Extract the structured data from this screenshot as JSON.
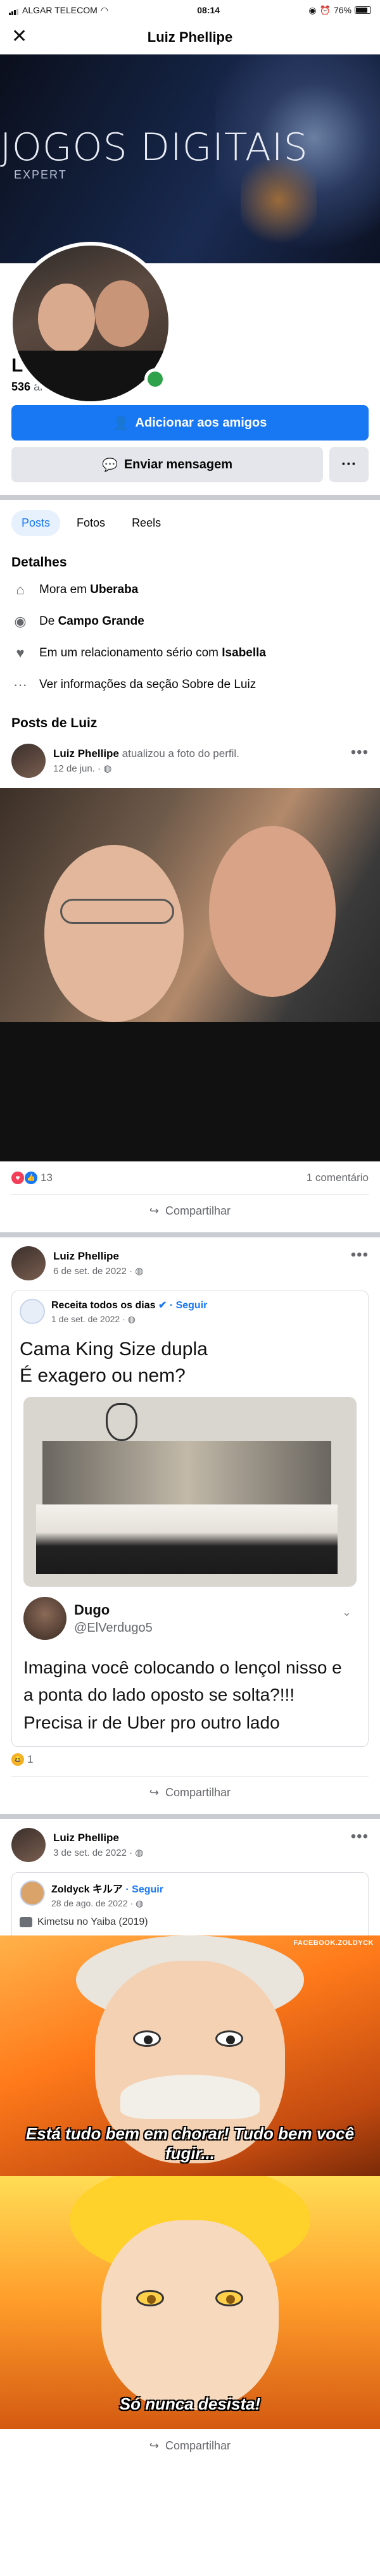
{
  "status_bar": {
    "carrier": "ALGAR TELECOM",
    "time": "08:14",
    "battery": "76%"
  },
  "header": {
    "title": "Luiz Phellipe"
  },
  "cover": {
    "brand": "JOGOS DIGITAIS",
    "brand_sub": "EXPERT"
  },
  "profile": {
    "name": "Luiz Phellipe",
    "friends_count": "536",
    "friends_label": "amigos",
    "add_friend_label": "Adicionar aos amigos",
    "message_label": "Enviar mensagem",
    "more_label": "···"
  },
  "tabs": [
    {
      "label": "Posts"
    },
    {
      "label": "Fotos"
    },
    {
      "label": "Reels"
    }
  ],
  "details": {
    "title": "Detalhes",
    "lives_prefix": "Mora em",
    "lives_city": "Uberaba",
    "from_prefix": "De",
    "from_city": "Campo Grande",
    "relationship_prefix": "Em um relacionamento sério com",
    "relationship_name": "Isabella",
    "about_link": "Ver informações da seção Sobre de Luiz"
  },
  "posts_title": "Posts de Luiz",
  "posts": [
    {
      "author": "Luiz Phellipe",
      "action": "atualizou a foto do perfil.",
      "time": "12 de jun. ·",
      "reactions_count": "13",
      "comments": "1 comentário",
      "share_label": "Compartilhar"
    },
    {
      "author": "Luiz Phellipe",
      "time": "6 de set. de 2022 ·",
      "shared_page": "Receita todos os dias",
      "follow_label": "· Seguir",
      "shared_time": "1 de set. de 2022 ·",
      "shared_text": "Cama King Size dupla\nÉ exagero ou nem?",
      "tweet_name": "Dugo",
      "tweet_handle": "@ElVerdugo5",
      "tweet_text": "Imagina você colocando o lençol nisso e a ponta do lado oposto se solta?!!! Precisa ir de Uber pro outro lado",
      "reactions_count": "1",
      "share_label": "Compartilhar"
    },
    {
      "author": "Luiz Phellipe",
      "time": "3 de set. de 2022 ·",
      "shared_page": "Zoldyck キルア",
      "follow_label": "· Seguir",
      "shared_time": "28 de ago. de 2022 ·",
      "tag": "Kimetsu no Yaiba (2019)",
      "watermark": "FACEBOOK.ZOLDYCK",
      "subtitle1": "Está tudo bem em chorar! Tudo bem você fugir...",
      "subtitle2": "Só nunca desista!",
      "share_label": "Compartilhar"
    }
  ],
  "colors": {
    "accent": "#1877f2",
    "online": "#31a24c",
    "secondary_bg": "#e4e6eb"
  }
}
